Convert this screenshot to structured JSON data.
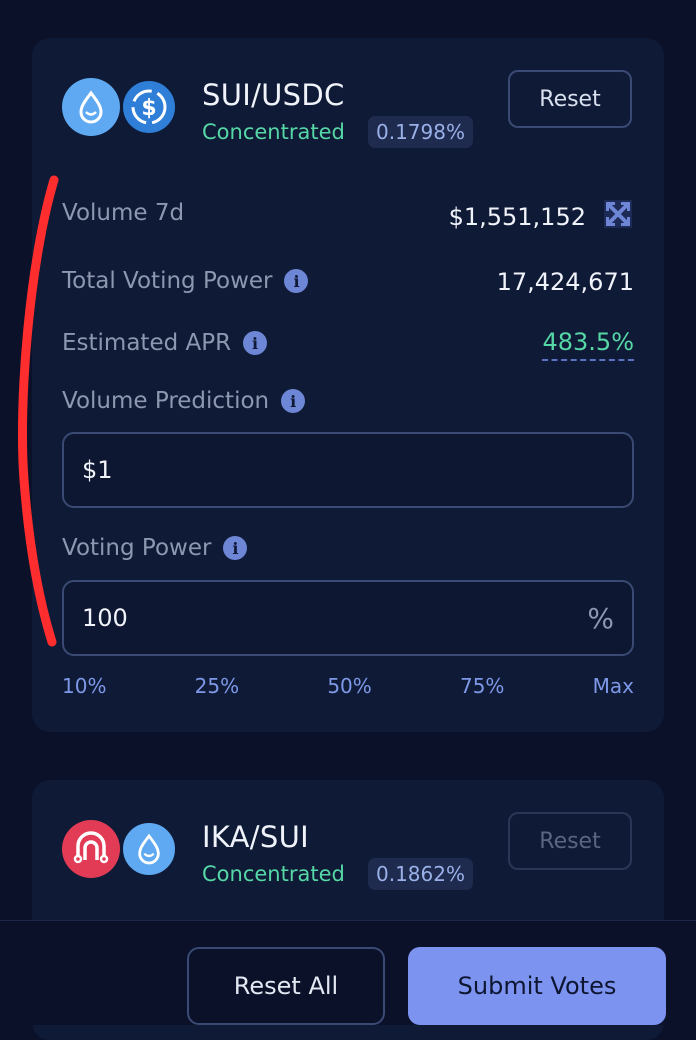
{
  "pools": [
    {
      "name": "SUI/USDC",
      "type": "Concentrated",
      "fee": "0.1798%",
      "reset_label": "Reset",
      "icons": [
        "sui-coin-icon",
        "usdc-coin-icon"
      ]
    },
    {
      "name": "IKA/SUI",
      "type": "Concentrated",
      "fee": "0.1862%",
      "reset_label": "Reset",
      "icons": [
        "ika-coin-icon",
        "sui-coin-icon"
      ]
    }
  ],
  "stats": {
    "volume_label": "Volume 7d",
    "volume_value": "$1,551,152",
    "total_voting_power_label": "Total Voting Power",
    "total_voting_power_value": "17,424,671",
    "estimated_apr_label": "Estimated APR",
    "estimated_apr_value": "483.5%"
  },
  "volume_prediction": {
    "label": "Volume Prediction",
    "value": "$1"
  },
  "voting_power": {
    "label": "Voting Power",
    "value": "100",
    "suffix": "%",
    "presets": [
      "10%",
      "25%",
      "50%",
      "75%",
      "Max"
    ]
  },
  "footer": {
    "reset_all_label": "Reset All",
    "submit_label": "Submit Votes"
  },
  "colors": {
    "background": "#0a1128",
    "card": "#0f1a36",
    "accent_green": "#55d7a6",
    "accent_blue": "#7c93f0",
    "annotation_red": "#ff2d2d"
  }
}
